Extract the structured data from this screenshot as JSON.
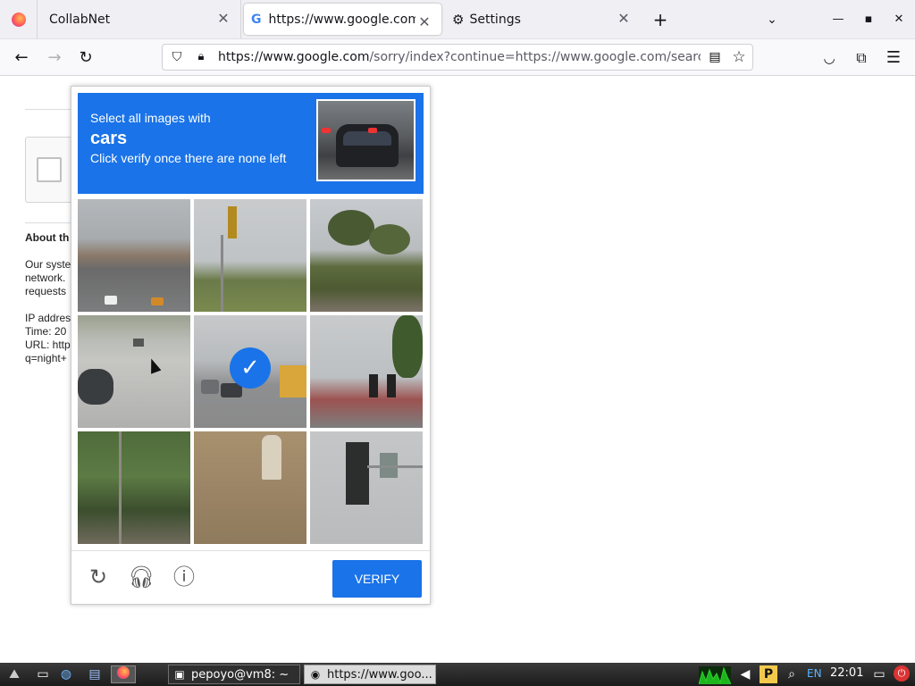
{
  "browser": {
    "tabs": [
      {
        "label": "CollabNet"
      },
      {
        "label": "https://www.google.com/sorry/index?continue"
      },
      {
        "label": "Settings"
      }
    ],
    "url": {
      "host": "https://www.google.com",
      "path": "/sorry/index?continue=https://www.google.com/search?q=night+"
    }
  },
  "page": {
    "about_heading": "About th",
    "lines": [
      "Our syste",
      "network.",
      "requests",
      "IP addres",
      "Time: 20",
      "URL: http",
      "q=night+"
    ]
  },
  "captcha": {
    "instruction": "Select all images with",
    "target": "cars",
    "subtext": "Click verify once there are none left",
    "verify_label": "VERIFY",
    "selected_tile": 5,
    "colors": {
      "accent": "#1a73e8"
    }
  },
  "taskbar": {
    "terminal_label": "pepoyo@vm8: ~",
    "browser_label": "https://www.goo...",
    "language": "EN",
    "clock": "22:01"
  }
}
